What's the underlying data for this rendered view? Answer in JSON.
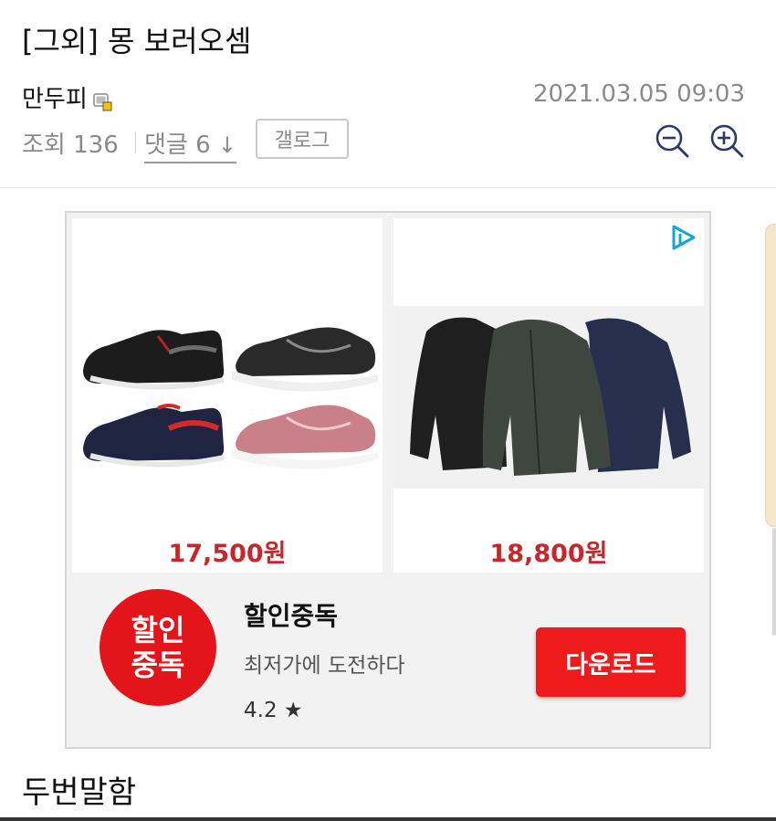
{
  "post": {
    "title": "[그외] 몽 보러오셈",
    "author": "만두피",
    "date": "2021.03.05 09:03",
    "views": "조회 136",
    "comments": "댓글 6",
    "comments_arrow": "↓",
    "gallog_label": "갤로그",
    "body_first_line": "두번말함"
  },
  "ad": {
    "products": [
      {
        "name": "sneakers-image",
        "price": "17,500원"
      },
      {
        "name": "jackets-image",
        "price": "18,800원"
      }
    ],
    "app": {
      "logo_line1": "할인",
      "logo_line2": "중독",
      "name": "할인중독",
      "description": "최저가에 도전하다",
      "rating": "4.2 ★",
      "cta": "다운로드"
    },
    "brand_color": "#ee1a1c",
    "price_color": "#c9262b"
  },
  "icons": {
    "zoom_out": "zoom-out-icon",
    "zoom_in": "zoom-in-icon",
    "ad_choices": "ad-choices-icon",
    "badge": "member-badge-icon"
  }
}
